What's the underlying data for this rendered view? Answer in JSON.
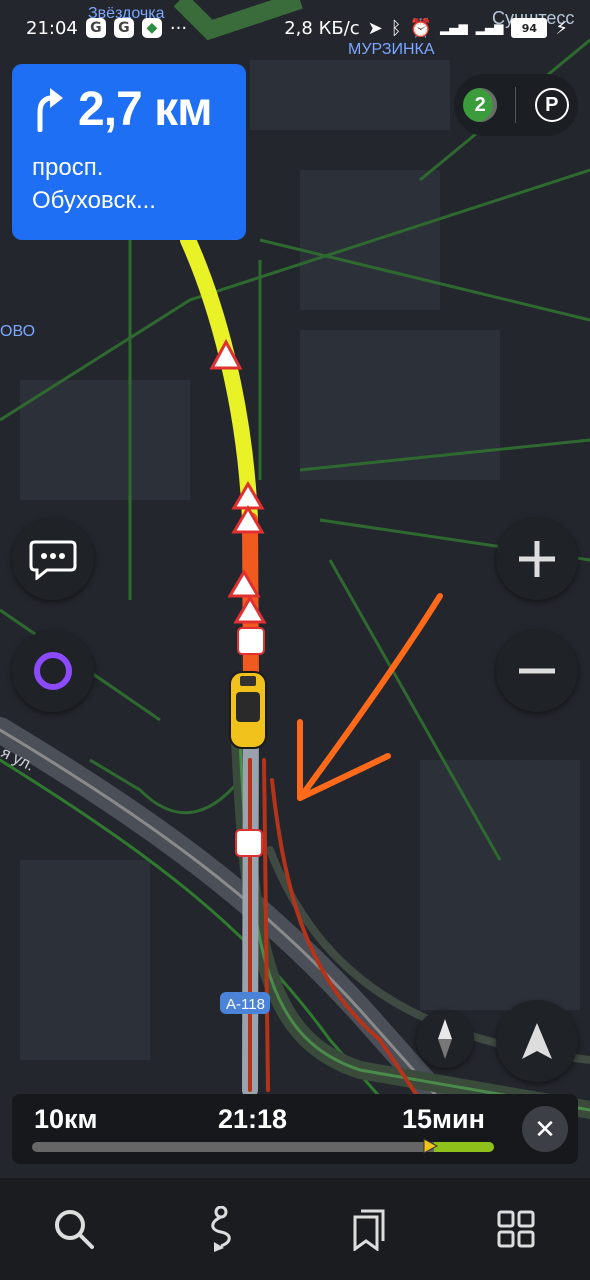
{
  "status_bar": {
    "time": "21:04",
    "net_speed": "2,8 КБ/с",
    "battery": "94",
    "more": "···",
    "app_icons": [
      "google-icon",
      "google-icon",
      "maps-icon"
    ],
    "right_icons": [
      "location-arrow-icon",
      "bluetooth-icon",
      "alarm-icon",
      "signal-4g-icon",
      "signal-icon"
    ]
  },
  "map_labels": {
    "north": "Звёздочка",
    "district": "МУРЗИНКА",
    "top_right": "Сунштесс",
    "left": "ОВО",
    "street": "я ул.",
    "road_shield": "А-118"
  },
  "maneuver": {
    "icon": "turn-right-arrow-icon",
    "distance": "2,7 км",
    "street_line1": "просп.",
    "street_line2": "Обуховск..."
  },
  "top_controls": {
    "traffic_level": "2",
    "parking_letter": "P"
  },
  "side_controls": {
    "left": [
      "chat-icon",
      "alice-icon"
    ],
    "right": [
      "zoom-in-icon",
      "zoom-out-icon",
      "compass-icon",
      "navigation-arrow-icon"
    ]
  },
  "trip": {
    "distance": "10км",
    "arrival": "21:18",
    "duration": "15мин",
    "progress": 0.13
  },
  "bottom_nav": [
    "search-icon",
    "route-icon",
    "bookmarks-icon",
    "menu-grid-icon"
  ],
  "colors": {
    "accent": "#1e6ff3",
    "route_red": "#f05a1e",
    "route_yellow": "#e9f227",
    "annotation": "#ff6a1a",
    "alice": "#8c4bff"
  }
}
